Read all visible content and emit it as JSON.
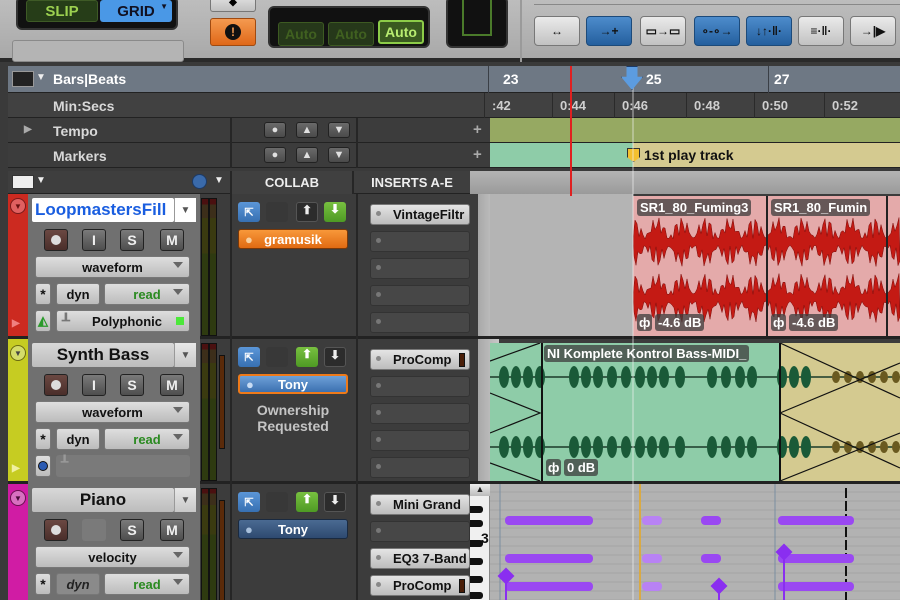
{
  "toolbar": {
    "edit_modes": {
      "slip": "SLIP",
      "grid": "GRID"
    },
    "alert_icon": "!",
    "auto_buttons": [
      "Auto",
      "Auto",
      "Auto"
    ],
    "tools": [
      {
        "name": "zoom-tool",
        "glyph": "↔",
        "active": false
      },
      {
        "name": "trim-tool",
        "glyph": "→+",
        "active": true
      },
      {
        "name": "clip-tool",
        "glyph": "▭→▭",
        "active": false
      },
      {
        "name": "automation-tool",
        "glyph": "∘-∘→",
        "active": true
      },
      {
        "name": "spacing-tool",
        "glyph": "↓↑·‖·",
        "active": true
      },
      {
        "name": "grid-tool",
        "glyph": "≡·‖·",
        "active": false
      },
      {
        "name": "nudge-tool",
        "glyph": "→|▶",
        "active": false
      }
    ]
  },
  "rulers": {
    "bars_beats": {
      "label": "Bars|Beats",
      "ticks": [
        "23",
        "25",
        "27"
      ]
    },
    "min_secs": {
      "label": "Min:Secs",
      "ticks": [
        ":42",
        "0:44",
        "0:46",
        "0:48",
        "0:50",
        "0:52"
      ]
    },
    "tempo": {
      "label": "Tempo"
    },
    "markers": {
      "label": "Markers",
      "marker_text": "1st play track"
    }
  },
  "columns": {
    "collab": "COLLAB",
    "inserts": "INSERTS A-E"
  },
  "tracks": [
    {
      "name": "LoopmastersFill",
      "color": "#d62a22",
      "view": "waveform",
      "dyn": "dyn",
      "automation": "read",
      "elastic": "Polyphonic",
      "collab_user": "gramusik",
      "collab_status": "",
      "inserts": [
        "VintageFiltr",
        "",
        "",
        "",
        ""
      ],
      "clips": [
        {
          "name": "SR1_80_Fuming3",
          "gain": "-4.6 dB"
        },
        {
          "name": "SR1_80_Fumin",
          "gain": "-4.6 dB"
        }
      ]
    },
    {
      "name": "Synth Bass",
      "color": "#c8cc1c",
      "view": "waveform",
      "dyn": "dyn",
      "automation": "read",
      "elastic": "",
      "collab_user": "Tony",
      "collab_status": "Ownership Requested",
      "inserts": [
        "ProComp",
        "",
        "",
        "",
        ""
      ],
      "clips": [
        {
          "name": "NI Komplete Kontrol Bass-MIDI_",
          "gain": "0 dB"
        }
      ]
    },
    {
      "name": "Piano",
      "color": "#d41ca8",
      "view": "velocity",
      "dyn": "dyn",
      "automation": "read",
      "collab_user": "Tony",
      "inserts": [
        "Mini Grand",
        "",
        "EQ3 7-Band",
        "ProComp"
      ],
      "keyboard_label": "3"
    }
  ]
}
